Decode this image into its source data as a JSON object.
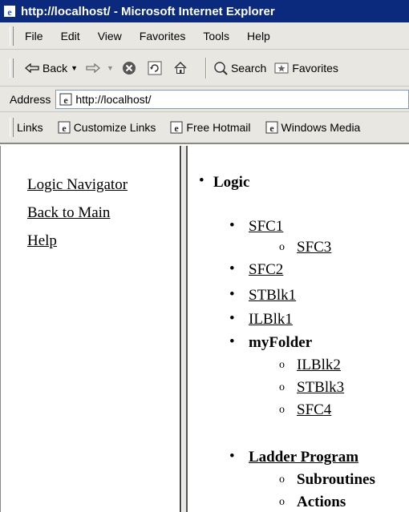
{
  "window": {
    "title": "http://localhost/ - Microsoft Internet Explorer"
  },
  "menu": [
    "File",
    "Edit",
    "View",
    "Favorites",
    "Tools",
    "Help"
  ],
  "toolbar": {
    "back": "Back",
    "search": "Search",
    "favorites": "Favorites"
  },
  "address": {
    "label": "Address",
    "url": "http://localhost/"
  },
  "links": {
    "label": "Links",
    "items": [
      "Customize Links",
      "Free Hotmail",
      "Windows Media"
    ]
  },
  "left_nav": [
    "Logic Navigator",
    "Back to Main",
    "Help"
  ],
  "tree": {
    "root": "Logic",
    "sfc1": "SFC1",
    "sfc3": "SFC3",
    "sfc2": "SFC2",
    "stblk1": "STBlk1",
    "ilblk1": "ILBlk1",
    "folder": "myFolder",
    "ilblk2": "ILBlk2",
    "stblk3": "STBlk3",
    "sfc4": "SFC4",
    "ladder": "Ladder Program",
    "subroutines": "Subroutines",
    "actions": "Actions"
  }
}
